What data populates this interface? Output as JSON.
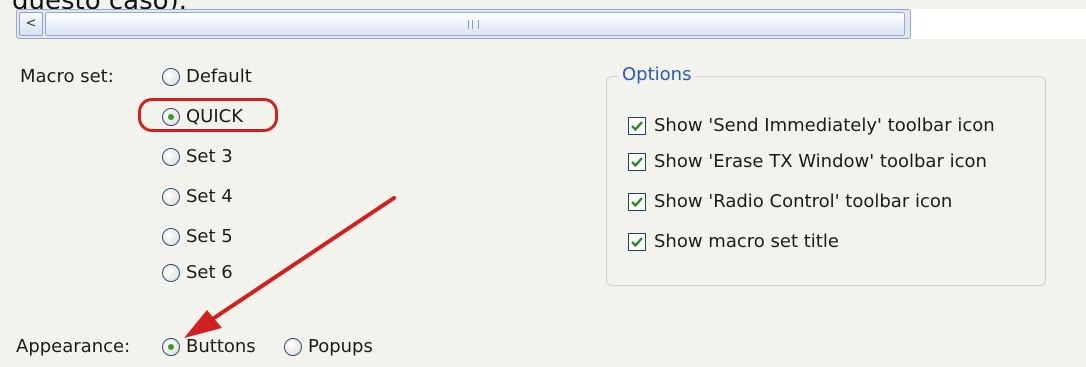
{
  "caption": "questo caso).",
  "scrollbar": {
    "left_arrow": "<",
    "grip": "|||"
  },
  "macro_set": {
    "label": "Macro set:",
    "options": [
      {
        "label": "Default",
        "checked": false
      },
      {
        "label": "QUICK",
        "checked": true
      },
      {
        "label": "Set 3",
        "checked": false
      },
      {
        "label": "Set 4",
        "checked": false
      },
      {
        "label": "Set 5",
        "checked": false
      },
      {
        "label": "Set 6",
        "checked": false
      }
    ]
  },
  "appearance": {
    "label": "Appearance:",
    "options": [
      {
        "label": "Buttons",
        "checked": true
      },
      {
        "label": "Popups",
        "checked": false
      }
    ]
  },
  "options_group": {
    "title": "Options",
    "items": [
      {
        "label": "Show 'Send Immediately' toolbar icon",
        "checked": true
      },
      {
        "label": "Show 'Erase TX Window' toolbar icon",
        "checked": true
      },
      {
        "label": "Show 'Radio Control' toolbar icon",
        "checked": true
      },
      {
        "label": "Show macro set title",
        "checked": true
      }
    ]
  },
  "colors": {
    "annotation": "#d21f1f",
    "group_title": "#2a56c8",
    "radio_dot": "#3a9a2a",
    "checkmark": "#2a8a1e"
  }
}
